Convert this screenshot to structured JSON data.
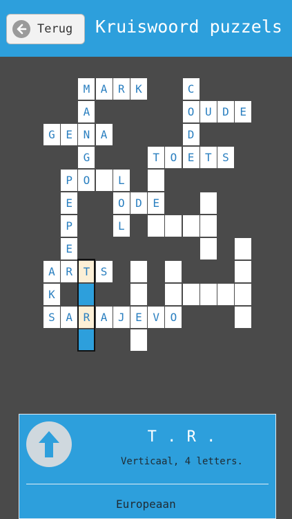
{
  "header": {
    "back_label": "Terug",
    "title": "Kruiswoord puzzels",
    "back_icon": "arrow-left-icon",
    "color": "#2d9fdc"
  },
  "grid": {
    "cells": [
      {
        "row": 0,
        "col": 2,
        "letter": "M",
        "state": "normal"
      },
      {
        "row": 0,
        "col": 3,
        "letter": "A",
        "state": "normal"
      },
      {
        "row": 0,
        "col": 4,
        "letter": "R",
        "state": "normal"
      },
      {
        "row": 0,
        "col": 5,
        "letter": "K",
        "state": "normal"
      },
      {
        "row": 0,
        "col": 8,
        "letter": "C",
        "state": "normal"
      },
      {
        "row": 1,
        "col": 2,
        "letter": "A",
        "state": "normal"
      },
      {
        "row": 1,
        "col": 8,
        "letter": "O",
        "state": "normal"
      },
      {
        "row": 1,
        "col": 9,
        "letter": "U",
        "state": "normal"
      },
      {
        "row": 1,
        "col": 10,
        "letter": "D",
        "state": "normal"
      },
      {
        "row": 1,
        "col": 11,
        "letter": "E",
        "state": "normal"
      },
      {
        "row": 2,
        "col": 0,
        "letter": "G",
        "state": "normal"
      },
      {
        "row": 2,
        "col": 1,
        "letter": "E",
        "state": "normal"
      },
      {
        "row": 2,
        "col": 2,
        "letter": "N",
        "state": "normal"
      },
      {
        "row": 2,
        "col": 3,
        "letter": "A",
        "state": "normal"
      },
      {
        "row": 2,
        "col": 8,
        "letter": "D",
        "state": "normal"
      },
      {
        "row": 3,
        "col": 2,
        "letter": "G",
        "state": "normal"
      },
      {
        "row": 3,
        "col": 6,
        "letter": "T",
        "state": "normal"
      },
      {
        "row": 3,
        "col": 7,
        "letter": "O",
        "state": "normal"
      },
      {
        "row": 3,
        "col": 8,
        "letter": "E",
        "state": "normal"
      },
      {
        "row": 3,
        "col": 9,
        "letter": "T",
        "state": "normal"
      },
      {
        "row": 3,
        "col": 10,
        "letter": "S",
        "state": "normal"
      },
      {
        "row": 4,
        "col": 1,
        "letter": "P",
        "state": "normal"
      },
      {
        "row": 4,
        "col": 2,
        "letter": "O",
        "state": "normal"
      },
      {
        "row": 4,
        "col": 3,
        "letter": "",
        "state": "normal"
      },
      {
        "row": 4,
        "col": 4,
        "letter": "L",
        "state": "normal"
      },
      {
        "row": 4,
        "col": 6,
        "letter": "",
        "state": "normal"
      },
      {
        "row": 5,
        "col": 1,
        "letter": "E",
        "state": "normal"
      },
      {
        "row": 5,
        "col": 4,
        "letter": "O",
        "state": "normal"
      },
      {
        "row": 5,
        "col": 5,
        "letter": "D",
        "state": "normal"
      },
      {
        "row": 5,
        "col": 6,
        "letter": "E",
        "state": "normal"
      },
      {
        "row": 5,
        "col": 9,
        "letter": "",
        "state": "normal"
      },
      {
        "row": 6,
        "col": 1,
        "letter": "P",
        "state": "normal"
      },
      {
        "row": 6,
        "col": 4,
        "letter": "L",
        "state": "normal"
      },
      {
        "row": 6,
        "col": 6,
        "letter": "",
        "state": "normal"
      },
      {
        "row": 6,
        "col": 7,
        "letter": "",
        "state": "normal"
      },
      {
        "row": 6,
        "col": 8,
        "letter": "",
        "state": "normal"
      },
      {
        "row": 6,
        "col": 9,
        "letter": "",
        "state": "normal"
      },
      {
        "row": 7,
        "col": 1,
        "letter": "E",
        "state": "normal"
      },
      {
        "row": 7,
        "col": 9,
        "letter": "",
        "state": "normal"
      },
      {
        "row": 7,
        "col": 11,
        "letter": "",
        "state": "normal"
      },
      {
        "row": 8,
        "col": 0,
        "letter": "A",
        "state": "normal"
      },
      {
        "row": 8,
        "col": 1,
        "letter": "R",
        "state": "normal"
      },
      {
        "row": 8,
        "col": 2,
        "letter": "T",
        "state": "cur"
      },
      {
        "row": 8,
        "col": 3,
        "letter": "S",
        "state": "normal"
      },
      {
        "row": 8,
        "col": 5,
        "letter": "",
        "state": "normal"
      },
      {
        "row": 8,
        "col": 7,
        "letter": "",
        "state": "normal"
      },
      {
        "row": 8,
        "col": 11,
        "letter": "",
        "state": "normal"
      },
      {
        "row": 9,
        "col": 0,
        "letter": "K",
        "state": "normal"
      },
      {
        "row": 9,
        "col": 2,
        "letter": "",
        "state": "sel"
      },
      {
        "row": 9,
        "col": 5,
        "letter": "",
        "state": "normal"
      },
      {
        "row": 9,
        "col": 7,
        "letter": "",
        "state": "normal"
      },
      {
        "row": 9,
        "col": 8,
        "letter": "",
        "state": "normal"
      },
      {
        "row": 9,
        "col": 9,
        "letter": "",
        "state": "normal"
      },
      {
        "row": 9,
        "col": 10,
        "letter": "",
        "state": "normal"
      },
      {
        "row": 9,
        "col": 11,
        "letter": "",
        "state": "normal"
      },
      {
        "row": 10,
        "col": 0,
        "letter": "S",
        "state": "normal"
      },
      {
        "row": 10,
        "col": 1,
        "letter": "A",
        "state": "normal"
      },
      {
        "row": 10,
        "col": 2,
        "letter": "R",
        "state": "cur"
      },
      {
        "row": 10,
        "col": 3,
        "letter": "A",
        "state": "normal"
      },
      {
        "row": 10,
        "col": 4,
        "letter": "J",
        "state": "normal"
      },
      {
        "row": 10,
        "col": 5,
        "letter": "E",
        "state": "normal"
      },
      {
        "row": 10,
        "col": 6,
        "letter": "V",
        "state": "normal"
      },
      {
        "row": 10,
        "col": 7,
        "letter": "O",
        "state": "normal"
      },
      {
        "row": 10,
        "col": 11,
        "letter": "",
        "state": "normal"
      },
      {
        "row": 11,
        "col": 2,
        "letter": "",
        "state": "sel"
      },
      {
        "row": 11,
        "col": 5,
        "letter": "",
        "state": "normal"
      }
    ]
  },
  "clue": {
    "pattern": "T.R.",
    "info": "Verticaal, 4 letters.",
    "text": "Europeaan",
    "up_icon": "arrow-up-icon"
  }
}
